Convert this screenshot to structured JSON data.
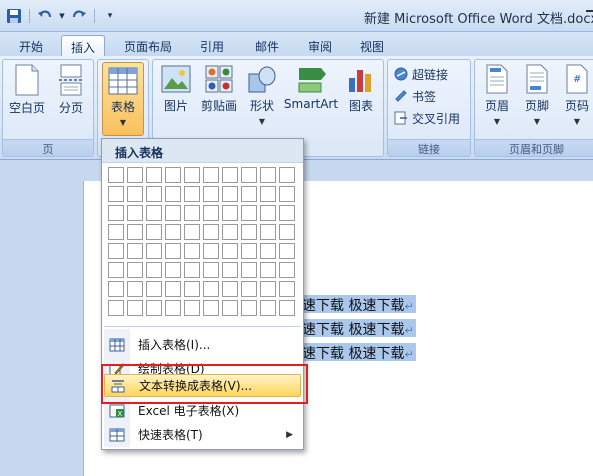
{
  "title": "新建 Microsoft Office Word 文档.docx -",
  "tabs": [
    {
      "label": "开始"
    },
    {
      "label": "插入"
    },
    {
      "label": "页面布局"
    },
    {
      "label": "引用"
    },
    {
      "label": "邮件"
    },
    {
      "label": "审阅"
    },
    {
      "label": "视图"
    }
  ],
  "ribbon": {
    "pages_group": {
      "label": "页",
      "cover": "空白页",
      "break": "分页"
    },
    "table_btn": "表格",
    "illustrations": {
      "picture": "图片",
      "clipart": "剪贴画",
      "shapes": "形状",
      "smartart": "SmartArt",
      "chart": "图表"
    },
    "links_group": {
      "label": "链接",
      "hyperlink": "超链接",
      "bookmark": "书签",
      "crossref": "交叉引用"
    },
    "headerfooter_group": {
      "label": "页眉和页脚",
      "header": "页眉",
      "footer": "页脚",
      "pagenum": "页码"
    }
  },
  "menu": {
    "header": "插入表格",
    "items": [
      {
        "label": "插入表格(I)..."
      },
      {
        "label": "绘制表格(D)"
      },
      {
        "label": "文本转换成表格(V)..."
      },
      {
        "label": "Excel 电子表格(X)"
      },
      {
        "label": "快速表格(T)"
      }
    ]
  },
  "document": {
    "lines": [
      "速下载  极速下载",
      "速下载  极速下载",
      "速下载  极速下载"
    ],
    "para_mark": "↵"
  }
}
